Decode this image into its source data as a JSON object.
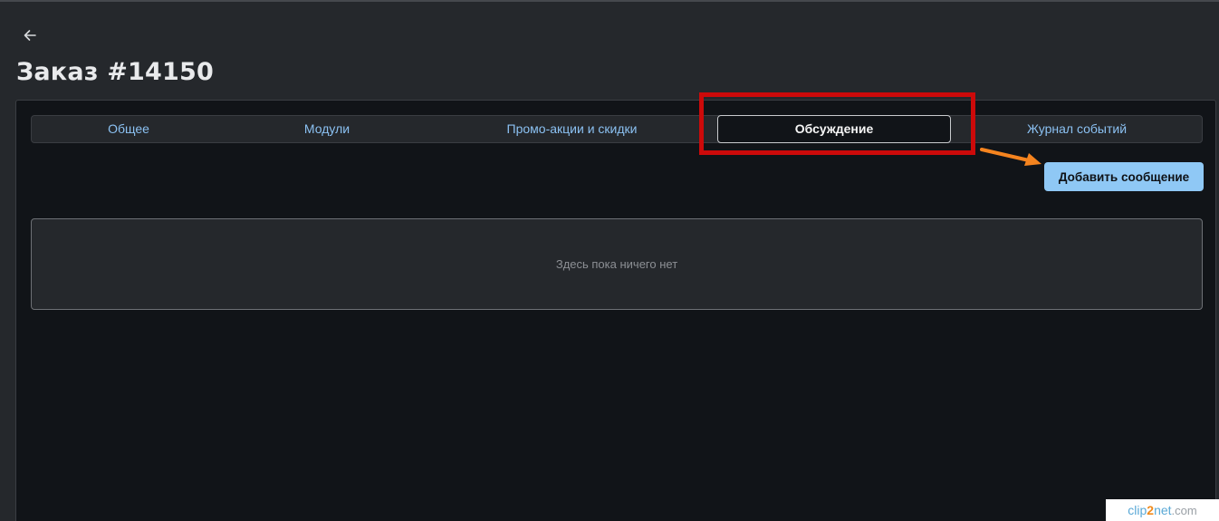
{
  "header": {
    "back_icon": "arrow-left-icon",
    "title": "Заказ #14150"
  },
  "tabs": [
    {
      "label": "Общее",
      "active": false
    },
    {
      "label": "Модули",
      "active": false
    },
    {
      "label": "Промо-акции и скидки",
      "active": false
    },
    {
      "label": "Обсуждение",
      "active": true
    },
    {
      "label": "Журнал событий",
      "active": false
    }
  ],
  "discussion": {
    "add_message_label": "Добавить сообщение",
    "empty_text": "Здесь пока ничего нет"
  },
  "annotation": {
    "highlight_color": "#cc0a0a",
    "arrow_color": "#f5841f"
  },
  "watermark": {
    "prefix": "clip",
    "accent": "2",
    "rest": "net",
    "suffix": ".com"
  },
  "colors": {
    "background": "#25282c",
    "panel": "#111418",
    "tab_text": "#8bc1f2",
    "primary_button": "#8fc8f5"
  }
}
